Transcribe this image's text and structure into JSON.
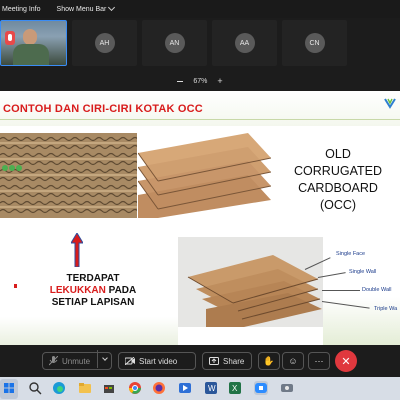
{
  "topbar": {
    "meeting_info": "Meeting Info",
    "show_menu_bar": "Show Menu Bar"
  },
  "participants": [
    {
      "kind": "video"
    },
    {
      "kind": "avatar",
      "initials": "AH"
    },
    {
      "kind": "avatar",
      "initials": "AN"
    },
    {
      "kind": "avatar",
      "initials": "AA"
    },
    {
      "kind": "avatar",
      "initials": "CN"
    }
  ],
  "zoom": {
    "minus": "−",
    "level": "67%",
    "plus": "+"
  },
  "slide": {
    "title": "CONTOH DAN CIRI-CIRI KOTAK OCC",
    "occ_lines": [
      "OLD",
      "CORRUGATED",
      "CARDBOARD",
      "(OCC)"
    ],
    "desc_line1": "TERDAPAT",
    "desc_red": "LEKUKKAN",
    "desc_line2_rest": " PADA",
    "desc_line3": "SETIAP LAPISAN",
    "layer_labels": [
      "Single Face",
      "Single Wall",
      "Double Wall",
      "Triple Wa"
    ]
  },
  "controls": {
    "unmute": "Unmute",
    "start_video": "Start video",
    "share": "Share"
  },
  "colors": {
    "accent_blue": "#3a8cf5",
    "title_red": "#d81c1c",
    "end_red": "#e0383e"
  },
  "icons": {
    "mic_off": "mic-off-icon",
    "video_off": "video-off-icon",
    "share": "share-icon",
    "raise_hand": "raise-hand-icon",
    "reactions": "emoji-icon",
    "more": "more-icon",
    "end": "end-call-icon"
  }
}
